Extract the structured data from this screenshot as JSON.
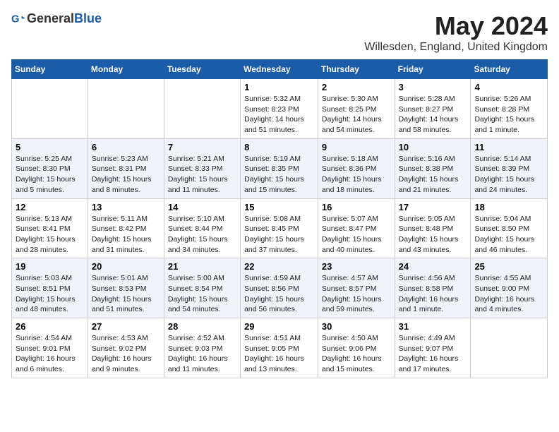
{
  "header": {
    "logo_general": "General",
    "logo_blue": "Blue",
    "title": "May 2024",
    "subtitle": "Willesden, England, United Kingdom"
  },
  "columns": [
    "Sunday",
    "Monday",
    "Tuesday",
    "Wednesday",
    "Thursday",
    "Friday",
    "Saturday"
  ],
  "weeks": [
    [
      {
        "day": "",
        "sunrise": "",
        "sunset": "",
        "daylight": "",
        "empty": true
      },
      {
        "day": "",
        "sunrise": "",
        "sunset": "",
        "daylight": "",
        "empty": true
      },
      {
        "day": "",
        "sunrise": "",
        "sunset": "",
        "daylight": "",
        "empty": true
      },
      {
        "day": "1",
        "sunrise": "Sunrise: 5:32 AM",
        "sunset": "Sunset: 8:23 PM",
        "daylight": "Daylight: 14 hours and 51 minutes.",
        "empty": false
      },
      {
        "day": "2",
        "sunrise": "Sunrise: 5:30 AM",
        "sunset": "Sunset: 8:25 PM",
        "daylight": "Daylight: 14 hours and 54 minutes.",
        "empty": false
      },
      {
        "day": "3",
        "sunrise": "Sunrise: 5:28 AM",
        "sunset": "Sunset: 8:27 PM",
        "daylight": "Daylight: 14 hours and 58 minutes.",
        "empty": false
      },
      {
        "day": "4",
        "sunrise": "Sunrise: 5:26 AM",
        "sunset": "Sunset: 8:28 PM",
        "daylight": "Daylight: 15 hours and 1 minute.",
        "empty": false
      }
    ],
    [
      {
        "day": "5",
        "sunrise": "Sunrise: 5:25 AM",
        "sunset": "Sunset: 8:30 PM",
        "daylight": "Daylight: 15 hours and 5 minutes.",
        "empty": false
      },
      {
        "day": "6",
        "sunrise": "Sunrise: 5:23 AM",
        "sunset": "Sunset: 8:31 PM",
        "daylight": "Daylight: 15 hours and 8 minutes.",
        "empty": false
      },
      {
        "day": "7",
        "sunrise": "Sunrise: 5:21 AM",
        "sunset": "Sunset: 8:33 PM",
        "daylight": "Daylight: 15 hours and 11 minutes.",
        "empty": false
      },
      {
        "day": "8",
        "sunrise": "Sunrise: 5:19 AM",
        "sunset": "Sunset: 8:35 PM",
        "daylight": "Daylight: 15 hours and 15 minutes.",
        "empty": false
      },
      {
        "day": "9",
        "sunrise": "Sunrise: 5:18 AM",
        "sunset": "Sunset: 8:36 PM",
        "daylight": "Daylight: 15 hours and 18 minutes.",
        "empty": false
      },
      {
        "day": "10",
        "sunrise": "Sunrise: 5:16 AM",
        "sunset": "Sunset: 8:38 PM",
        "daylight": "Daylight: 15 hours and 21 minutes.",
        "empty": false
      },
      {
        "day": "11",
        "sunrise": "Sunrise: 5:14 AM",
        "sunset": "Sunset: 8:39 PM",
        "daylight": "Daylight: 15 hours and 24 minutes.",
        "empty": false
      }
    ],
    [
      {
        "day": "12",
        "sunrise": "Sunrise: 5:13 AM",
        "sunset": "Sunset: 8:41 PM",
        "daylight": "Daylight: 15 hours and 28 minutes.",
        "empty": false
      },
      {
        "day": "13",
        "sunrise": "Sunrise: 5:11 AM",
        "sunset": "Sunset: 8:42 PM",
        "daylight": "Daylight: 15 hours and 31 minutes.",
        "empty": false
      },
      {
        "day": "14",
        "sunrise": "Sunrise: 5:10 AM",
        "sunset": "Sunset: 8:44 PM",
        "daylight": "Daylight: 15 hours and 34 minutes.",
        "empty": false
      },
      {
        "day": "15",
        "sunrise": "Sunrise: 5:08 AM",
        "sunset": "Sunset: 8:45 PM",
        "daylight": "Daylight: 15 hours and 37 minutes.",
        "empty": false
      },
      {
        "day": "16",
        "sunrise": "Sunrise: 5:07 AM",
        "sunset": "Sunset: 8:47 PM",
        "daylight": "Daylight: 15 hours and 40 minutes.",
        "empty": false
      },
      {
        "day": "17",
        "sunrise": "Sunrise: 5:05 AM",
        "sunset": "Sunset: 8:48 PM",
        "daylight": "Daylight: 15 hours and 43 minutes.",
        "empty": false
      },
      {
        "day": "18",
        "sunrise": "Sunrise: 5:04 AM",
        "sunset": "Sunset: 8:50 PM",
        "daylight": "Daylight: 15 hours and 46 minutes.",
        "empty": false
      }
    ],
    [
      {
        "day": "19",
        "sunrise": "Sunrise: 5:03 AM",
        "sunset": "Sunset: 8:51 PM",
        "daylight": "Daylight: 15 hours and 48 minutes.",
        "empty": false
      },
      {
        "day": "20",
        "sunrise": "Sunrise: 5:01 AM",
        "sunset": "Sunset: 8:53 PM",
        "daylight": "Daylight: 15 hours and 51 minutes.",
        "empty": false
      },
      {
        "day": "21",
        "sunrise": "Sunrise: 5:00 AM",
        "sunset": "Sunset: 8:54 PM",
        "daylight": "Daylight: 15 hours and 54 minutes.",
        "empty": false
      },
      {
        "day": "22",
        "sunrise": "Sunrise: 4:59 AM",
        "sunset": "Sunset: 8:56 PM",
        "daylight": "Daylight: 15 hours and 56 minutes.",
        "empty": false
      },
      {
        "day": "23",
        "sunrise": "Sunrise: 4:57 AM",
        "sunset": "Sunset: 8:57 PM",
        "daylight": "Daylight: 15 hours and 59 minutes.",
        "empty": false
      },
      {
        "day": "24",
        "sunrise": "Sunrise: 4:56 AM",
        "sunset": "Sunset: 8:58 PM",
        "daylight": "Daylight: 16 hours and 1 minute.",
        "empty": false
      },
      {
        "day": "25",
        "sunrise": "Sunrise: 4:55 AM",
        "sunset": "Sunset: 9:00 PM",
        "daylight": "Daylight: 16 hours and 4 minutes.",
        "empty": false
      }
    ],
    [
      {
        "day": "26",
        "sunrise": "Sunrise: 4:54 AM",
        "sunset": "Sunset: 9:01 PM",
        "daylight": "Daylight: 16 hours and 6 minutes.",
        "empty": false
      },
      {
        "day": "27",
        "sunrise": "Sunrise: 4:53 AM",
        "sunset": "Sunset: 9:02 PM",
        "daylight": "Daylight: 16 hours and 9 minutes.",
        "empty": false
      },
      {
        "day": "28",
        "sunrise": "Sunrise: 4:52 AM",
        "sunset": "Sunset: 9:03 PM",
        "daylight": "Daylight: 16 hours and 11 minutes.",
        "empty": false
      },
      {
        "day": "29",
        "sunrise": "Sunrise: 4:51 AM",
        "sunset": "Sunset: 9:05 PM",
        "daylight": "Daylight: 16 hours and 13 minutes.",
        "empty": false
      },
      {
        "day": "30",
        "sunrise": "Sunrise: 4:50 AM",
        "sunset": "Sunset: 9:06 PM",
        "daylight": "Daylight: 16 hours and 15 minutes.",
        "empty": false
      },
      {
        "day": "31",
        "sunrise": "Sunrise: 4:49 AM",
        "sunset": "Sunset: 9:07 PM",
        "daylight": "Daylight: 16 hours and 17 minutes.",
        "empty": false
      },
      {
        "day": "",
        "sunrise": "",
        "sunset": "",
        "daylight": "",
        "empty": true
      }
    ]
  ]
}
